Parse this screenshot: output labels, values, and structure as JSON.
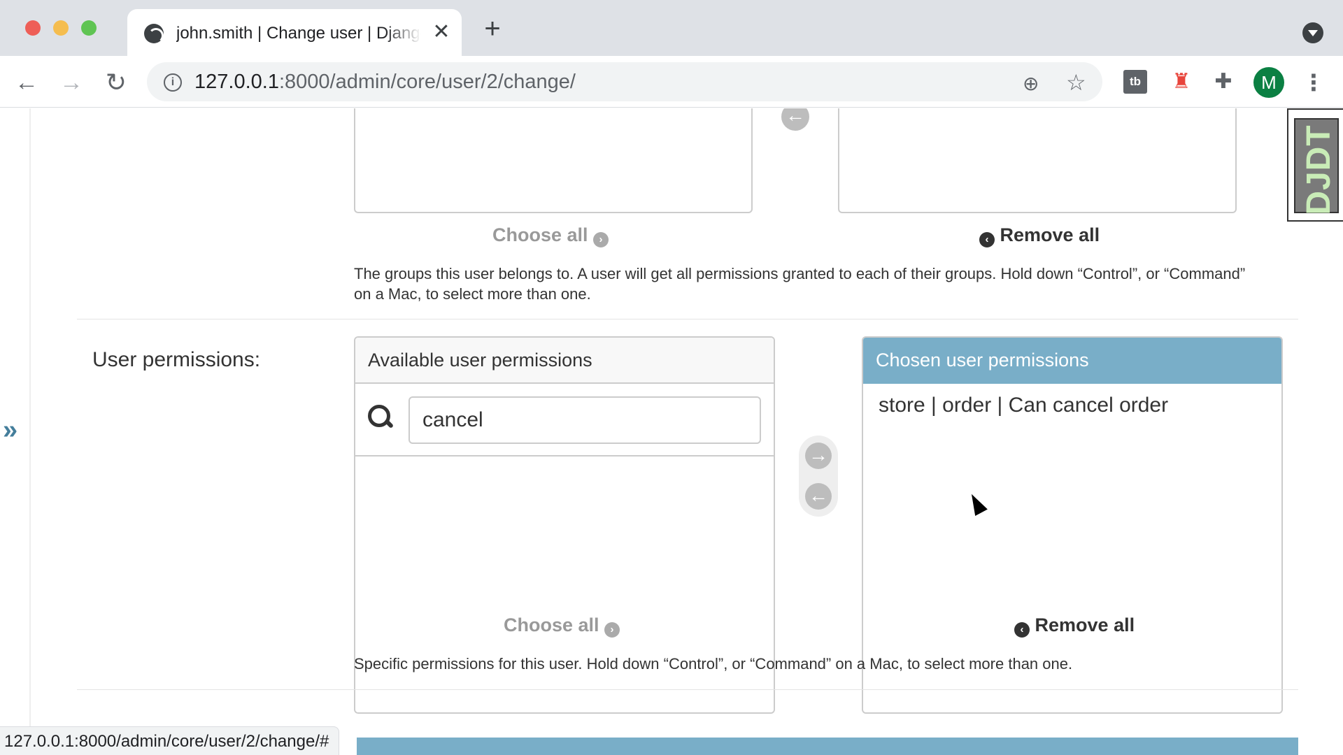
{
  "browser": {
    "tab_title": "john.smith | Change user | Django site admin",
    "tab_close": "✕",
    "new_tab": "+",
    "url_host": "127.0.0.1",
    "url_path": ":8000/admin/core/user/2/change/",
    "avatar_letter": "M",
    "ext_tb_label": "tb",
    "status_url": "127.0.0.1:8000/admin/core/user/2/change/#"
  },
  "groups": {
    "choose_all": "Choose all",
    "remove_all": "Remove all",
    "help": "The groups this user belongs to. A user will get all permissions granted to each of their groups. Hold down “Control”, or “Command” on a Mac, to select more than one."
  },
  "permissions": {
    "label": "User permissions:",
    "available_header": "Available user permissions",
    "filter_value": "cancel",
    "chosen_header": "Chosen user permissions",
    "chosen_items": [
      "store | order | Can cancel order"
    ],
    "choose_all": "Choose all",
    "remove_all": "Remove all",
    "help": "Specific permissions for this user. Hold down “Control”, or “Command” on a Mac, to select more than one."
  },
  "djdt": {
    "label": "DJDT"
  },
  "colors": {
    "django_blue": "#79aec8",
    "link_blue": "#447e9b"
  }
}
